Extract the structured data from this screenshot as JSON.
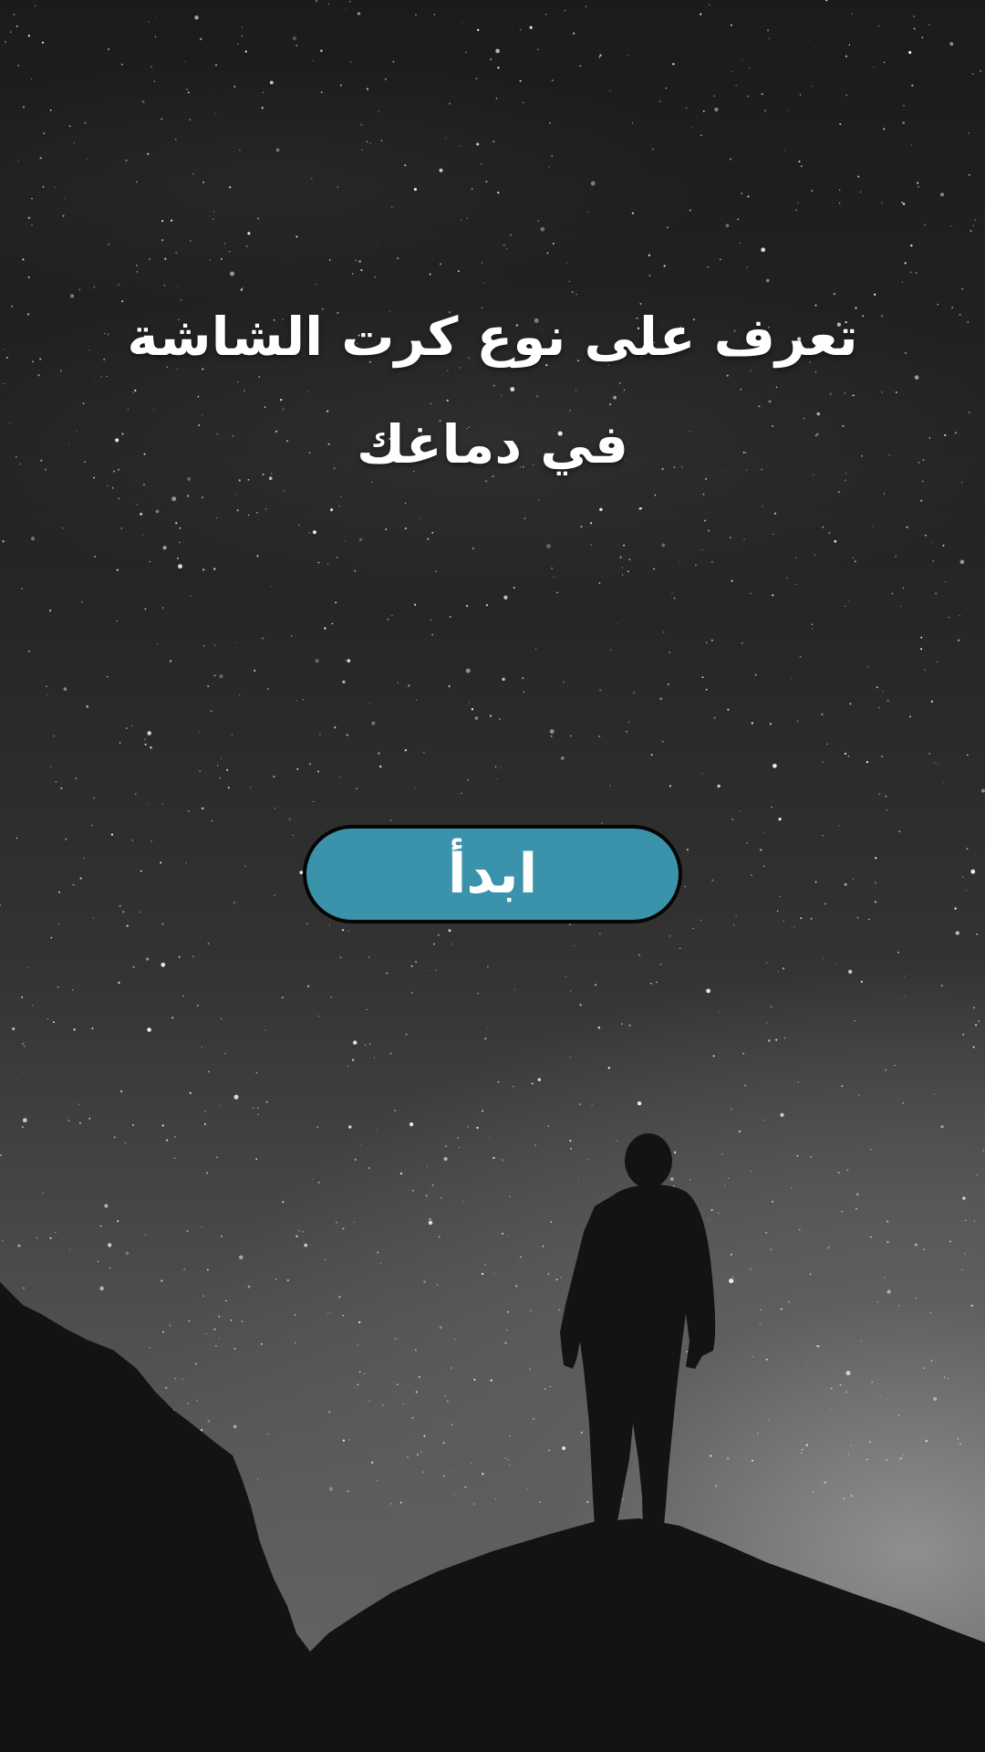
{
  "screen": {
    "title": "تعرف على نوع كرت الشاشة في دماغك",
    "start_button_label": "ابدأ",
    "accent_color": "#3a93aa",
    "background_image": "night-sky-hiker-silhouette"
  }
}
